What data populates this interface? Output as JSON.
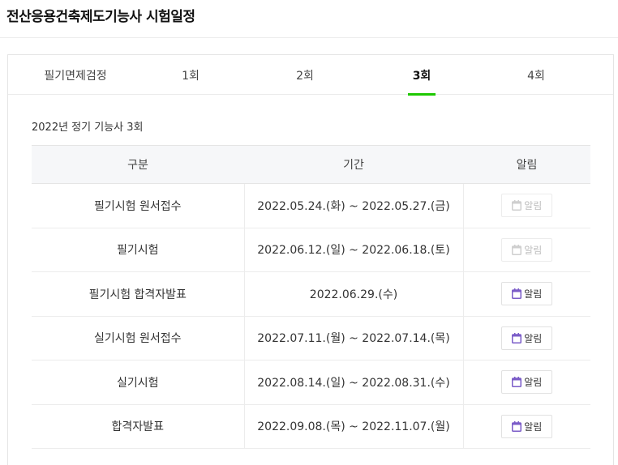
{
  "page": {
    "title": "전산응용건축제도기능사 시험일정"
  },
  "tabs": [
    {
      "label": "필기면제검정",
      "active": false
    },
    {
      "label": "1회",
      "active": false
    },
    {
      "label": "2회",
      "active": false
    },
    {
      "label": "3회",
      "active": true
    },
    {
      "label": "4회",
      "active": false
    }
  ],
  "section": {
    "title": "2022년 정기 기능사 3회"
  },
  "table": {
    "headers": {
      "category": "구분",
      "period": "기간",
      "alarm": "알림"
    },
    "rows": [
      {
        "category": "필기시험 원서접수",
        "period": "2022.05.24.(화) ~ 2022.05.27.(금)",
        "alarm": "알림",
        "alarm_enabled": false
      },
      {
        "category": "필기시험",
        "period": "2022.06.12.(일) ~ 2022.06.18.(토)",
        "alarm": "알림",
        "alarm_enabled": false
      },
      {
        "category": "필기시험 합격자발표",
        "period": "2022.06.29.(수)",
        "alarm": "알림",
        "alarm_enabled": true
      },
      {
        "category": "실기시험 원서접수",
        "period": "2022.07.11.(월) ~ 2022.07.14.(목)",
        "alarm": "알림",
        "alarm_enabled": true
      },
      {
        "category": "실기시험",
        "period": "2022.08.14.(일) ~ 2022.08.31.(수)",
        "alarm": "알림",
        "alarm_enabled": true
      },
      {
        "category": "합격자발표",
        "period": "2022.09.08.(목) ~ 2022.11.07.(월)",
        "alarm": "알림",
        "alarm_enabled": true
      }
    ]
  },
  "icons": {
    "alarm": "calendar-icon"
  },
  "colors": {
    "active_tab_underline": "#1ec800",
    "calendar_icon_enabled": "#7b5cc8",
    "calendar_icon_disabled": "#cfcfcf",
    "header_background": "#f6f7f9"
  }
}
